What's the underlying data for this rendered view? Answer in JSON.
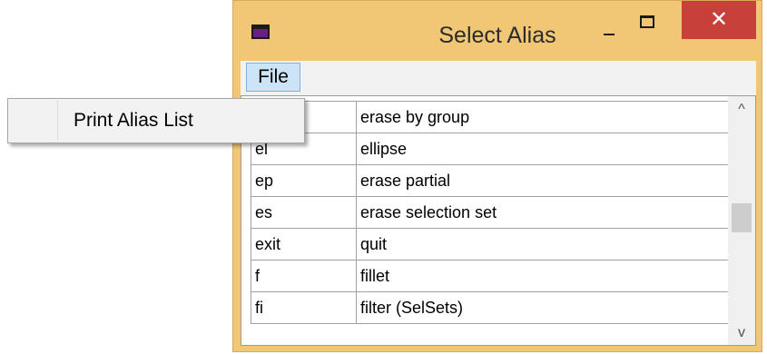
{
  "window": {
    "title": "Select Alias",
    "close_glyph": "✕",
    "icon": "app-window-icon"
  },
  "menubar": {
    "file_label": "File"
  },
  "popup": {
    "items": [
      {
        "label": "Print Alias List"
      }
    ]
  },
  "list": {
    "rows": [
      {
        "alias": "",
        "command": "erase by group"
      },
      {
        "alias": "el",
        "command": "ellipse"
      },
      {
        "alias": "ep",
        "command": "erase partial"
      },
      {
        "alias": "es",
        "command": "erase selection set"
      },
      {
        "alias": "exit",
        "command": "quit"
      },
      {
        "alias": "f",
        "command": "fillet"
      },
      {
        "alias": "fi",
        "command": "filter (SelSets)"
      }
    ],
    "scroll_up_glyph": "^",
    "scroll_down_glyph": "v"
  },
  "colors": {
    "frame": "#f1c776",
    "close_button": "#c7403a",
    "menu_highlight": "#cce4f7"
  }
}
